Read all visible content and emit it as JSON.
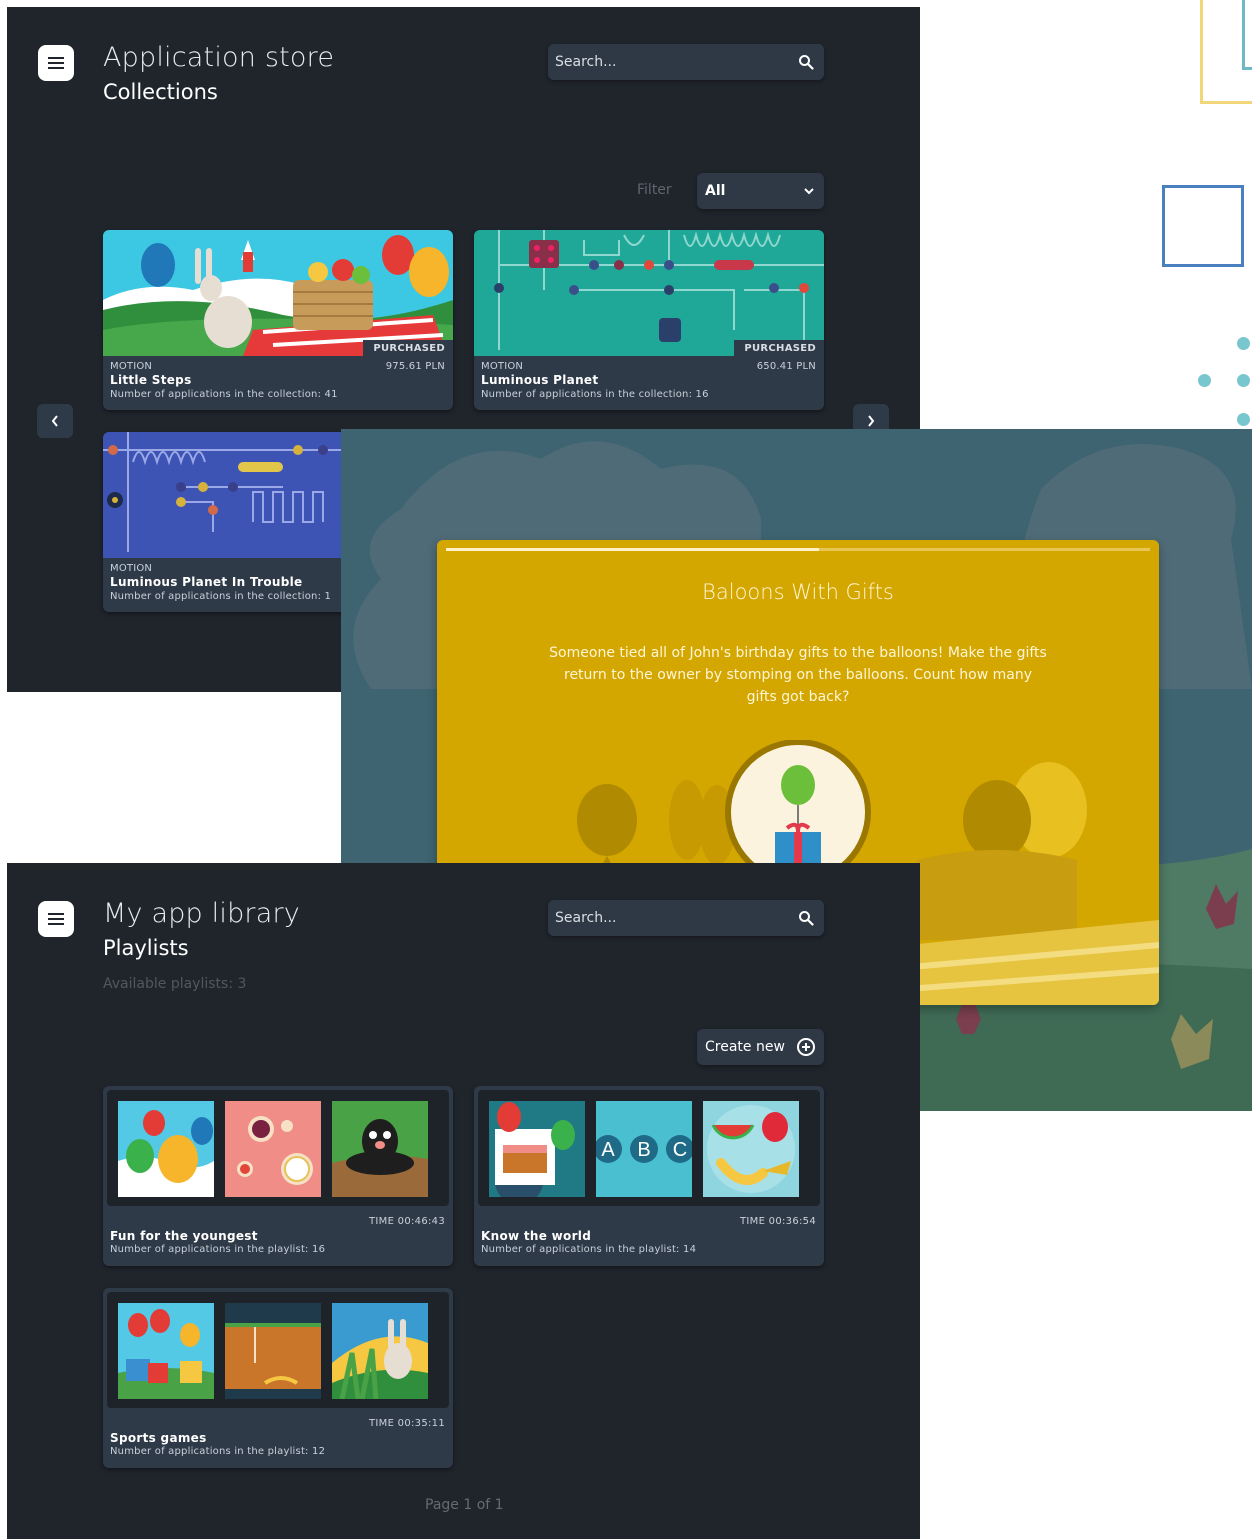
{
  "colors": {
    "panel_bg": "#20252c",
    "card_bg": "#2f3a48",
    "game_accent": "#d4a600",
    "game_bg": "#3d6470"
  },
  "store": {
    "title": "Application store",
    "subtitle": "Collections",
    "search_placeholder": "Search...",
    "filter_label": "Filter",
    "filter_value": "All",
    "collections": [
      {
        "category": "MOTION",
        "name": "Little Steps",
        "count_text": "Number of applications in the collection: 41",
        "price": "975.61 PLN",
        "badge": "PURCHASED",
        "icon": "picnic-bunny-image"
      },
      {
        "category": "MOTION",
        "name": "Luminous Planet",
        "count_text": "Number of applications in the collection: 16",
        "price": "650.41 PLN",
        "badge": "PURCHASED",
        "icon": "circuit-board-image"
      },
      {
        "category": "MOTION",
        "name": "Luminous Planet In Trouble",
        "count_text": "Number of applications in the collection: 1",
        "price": "",
        "badge": "",
        "icon": "circuit-board-image"
      }
    ]
  },
  "game": {
    "title": "Baloons With Gifts",
    "description": "Someone tied all of John's birthday gifts to the balloons! Make the gifts return to the owner by stomping on the balloons. Count how many gifts got back?",
    "progress": 0.53
  },
  "library": {
    "title": "My app library",
    "subtitle": "Playlists",
    "available": "Available playlists: 3",
    "search_placeholder": "Search...",
    "create_label": "Create new",
    "pagination": "Page 1 of 1",
    "playlists": [
      {
        "name": "Fun for the youngest",
        "count_text": "Number of applications in the playlist: 16",
        "time": "TIME 00:46:43"
      },
      {
        "name": "Know the world",
        "count_text": "Number of applications in the playlist: 14",
        "time": "TIME 00:36:54"
      },
      {
        "name": "Sports games",
        "count_text": "Number of applications in the playlist: 12",
        "time": "TIME 00:35:11"
      }
    ]
  }
}
